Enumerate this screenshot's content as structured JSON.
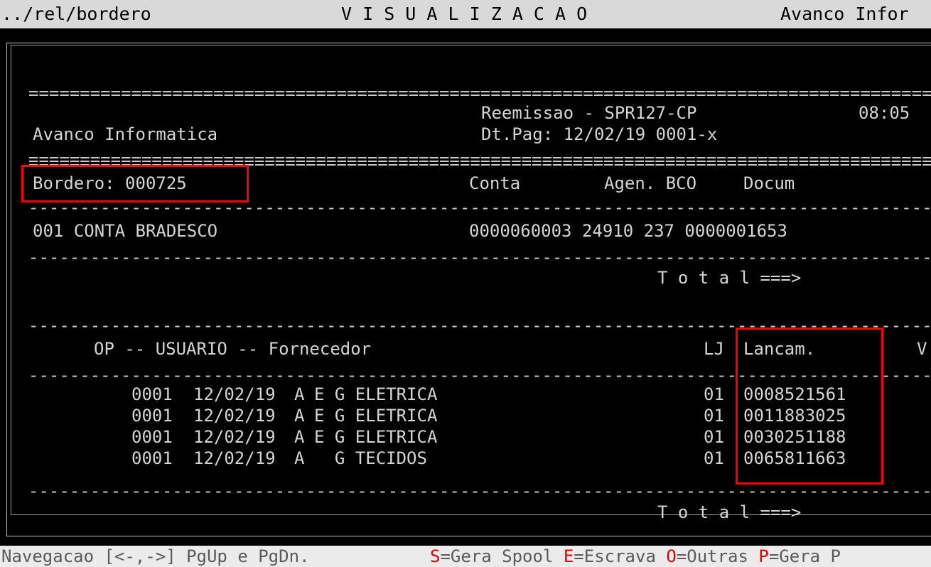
{
  "title_bar": {
    "path": "../rel/bordero",
    "mode": "V I S U A L I Z A C A O",
    "company": "Avanco Infor"
  },
  "report": {
    "separator_double": "=================================================================================================",
    "separator_single": "-------------------------------------------------------------------------------------------------",
    "header": {
      "reemissao": "Reemissao - SPR127-CP",
      "time": "08:05",
      "company": "Avanco Informatica",
      "dt_pag": "Dt.Pag: 12/02/19 0001-x"
    },
    "bordero": {
      "label": "Bordero: 000725",
      "col_conta": "Conta",
      "col_agen_bco": "Agen. BCO",
      "col_docum": "Docum"
    },
    "account": {
      "name": "001 CONTA BRADESCO",
      "details": "0000060003 24910 237 0000001653"
    },
    "total_label": "T o t a l ===>",
    "detail_header": {
      "op_user_fornecedor": "OP -- USUARIO -- Fornecedor",
      "lj": "LJ",
      "lancam": "Lancam.",
      "clipped": "V"
    },
    "rows": [
      {
        "op": "0001",
        "date": "12/02/19",
        "user": "A",
        "fornecedor": "E G ELETRICA",
        "lj": "01",
        "lancam": "0008521561"
      },
      {
        "op": "0001",
        "date": "12/02/19",
        "user": "A",
        "fornecedor": "E G ELETRICA",
        "lj": "01",
        "lancam": "0011883025"
      },
      {
        "op": "0001",
        "date": "12/02/19",
        "user": "A",
        "fornecedor": "E G ELETRICA",
        "lj": "01",
        "lancam": "0030251188"
      },
      {
        "op": "0001",
        "date": "12/02/19",
        "user": "A",
        "fornecedor": "  G TECIDOS",
        "lj": "01",
        "lancam": "0065811663"
      }
    ]
  },
  "status_bar": {
    "nav": "Navegacao [<-,->] PgUp e PgDn.",
    "s_key": "S",
    "s_label": "=Gera Spool ",
    "e_key": "E",
    "e_label": "=Escrava ",
    "o_key": "O",
    "o_label": "=Outras ",
    "p_key": "P",
    "p_label": "=Gera P"
  },
  "colors": {
    "terminal_bg": "#000000",
    "terminal_fg": "#d4d4d4",
    "highlight": "#ff0000",
    "hotkey": "#e00000"
  }
}
